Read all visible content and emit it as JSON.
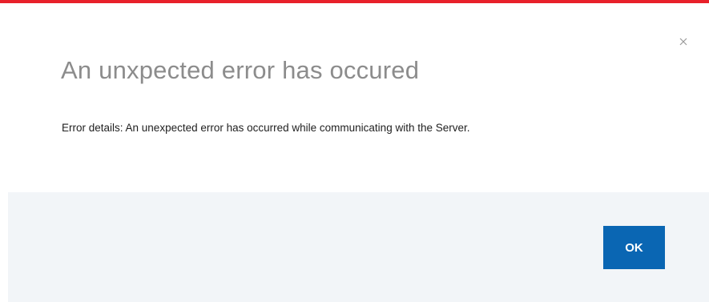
{
  "dialog": {
    "title": "An unxpected error has occured",
    "details": "Error details: An unexpected error has occurred while communicating with the Server.",
    "ok_label": "OK",
    "close_icon": "close-icon"
  },
  "colors": {
    "accent_top": "#e8202a",
    "primary_button": "#0a66b3",
    "footer_bg": "#f2f5f8",
    "title_text": "#8c8c8c"
  }
}
